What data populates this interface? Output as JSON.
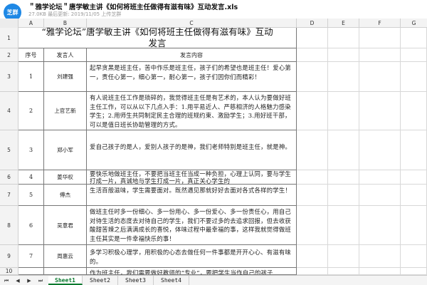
{
  "header": {
    "app_badge": "芝群",
    "file_title": "＂雅学论坛＂唐学敏主讲《如何将班主任做得有滋有味》互动发言.xls",
    "file_meta": "27.0KB 最后更新: 2019/11/05 上传芝群"
  },
  "columns": [
    "A",
    "B",
    "C",
    "D",
    "E",
    "F",
    "G"
  ],
  "rows": [
    "1",
    "2",
    "3",
    "4",
    "5",
    "6",
    "7",
    "8",
    "9",
    "10"
  ],
  "sheet": {
    "title": "“雅学论坛”唐学敏主讲《如何将班主任做得有滋有味》互动发言",
    "headers": {
      "no": "序号",
      "speaker": "发言人",
      "content": "发言内容"
    },
    "entries": [
      {
        "no": "1",
        "speaker": "刘建强",
        "content": "起早贪黑是班主任，苦中作乐是班主任，孩子们的希望也是班主任！爱心第一，责任心第一，细心第一，耐心第一，孩子们因你们而精彩！"
      },
      {
        "no": "2",
        "speaker": "上官艺新",
        "content": "有人说班主任工作是琐碎的，我觉得班主任是有艺术的，本人认为要做好班主任工作，可以从以下几点入手：1.用平易近人、严慈相济的人格魅力感染学生；2.用师生共同制定民主合理的班规约束、激励学生；3.用好班干部，可以是值日班长协助管理的方式。"
      },
      {
        "no": "3",
        "speaker": "郑小军",
        "content": "爱自己孩子的是人，爱别人孩子的是神，我们老师特别是班主任，就是神。"
      },
      {
        "no": "4",
        "speaker": "姜华权",
        "content": "要快乐地做班主任，不要把当班主任当成一种负担，心理上认同，要与学生打成一片，真诚地与学生打成一片，真正关心学生的"
      },
      {
        "no": "5",
        "speaker": "傅杰",
        "content": "生活百般滋味，学生需要面对。既然遇见那就好好去面对各式各样的学生！"
      },
      {
        "no": "6",
        "speaker": "吴意君",
        "content": "做班主任时多一份细心、多一份用心、多一份爱心、多一份责任心，用自己对待生活的态度去对待自己的学生，我们不要过多的去追求回报，但去收获酸甜苦辣之后满满成长的喜悦，体味过程中最幸福的事，这样我就觉得做班主任其实是一件幸福快乐的事！"
      },
      {
        "no": "7",
        "speaker": "周惠云",
        "content": "多学习积极心理学，用积极的心态去做任何一件事都是开开心心、有滋有味的。"
      }
    ],
    "partial_row_text": "作为班主任，我们需要做好教师的“专业”，要把学生当作自己的孩子"
  },
  "sheet_tabs": [
    "Sheet1",
    "Sheet2",
    "Sheet3",
    "Sheet4"
  ],
  "nav_icons": [
    "first-sheet-icon",
    "prev-sheet-icon",
    "next-sheet-icon",
    "last-sheet-icon"
  ],
  "colors": {
    "badge": "#1e88e5",
    "active_tab": "#0a7a2f"
  }
}
